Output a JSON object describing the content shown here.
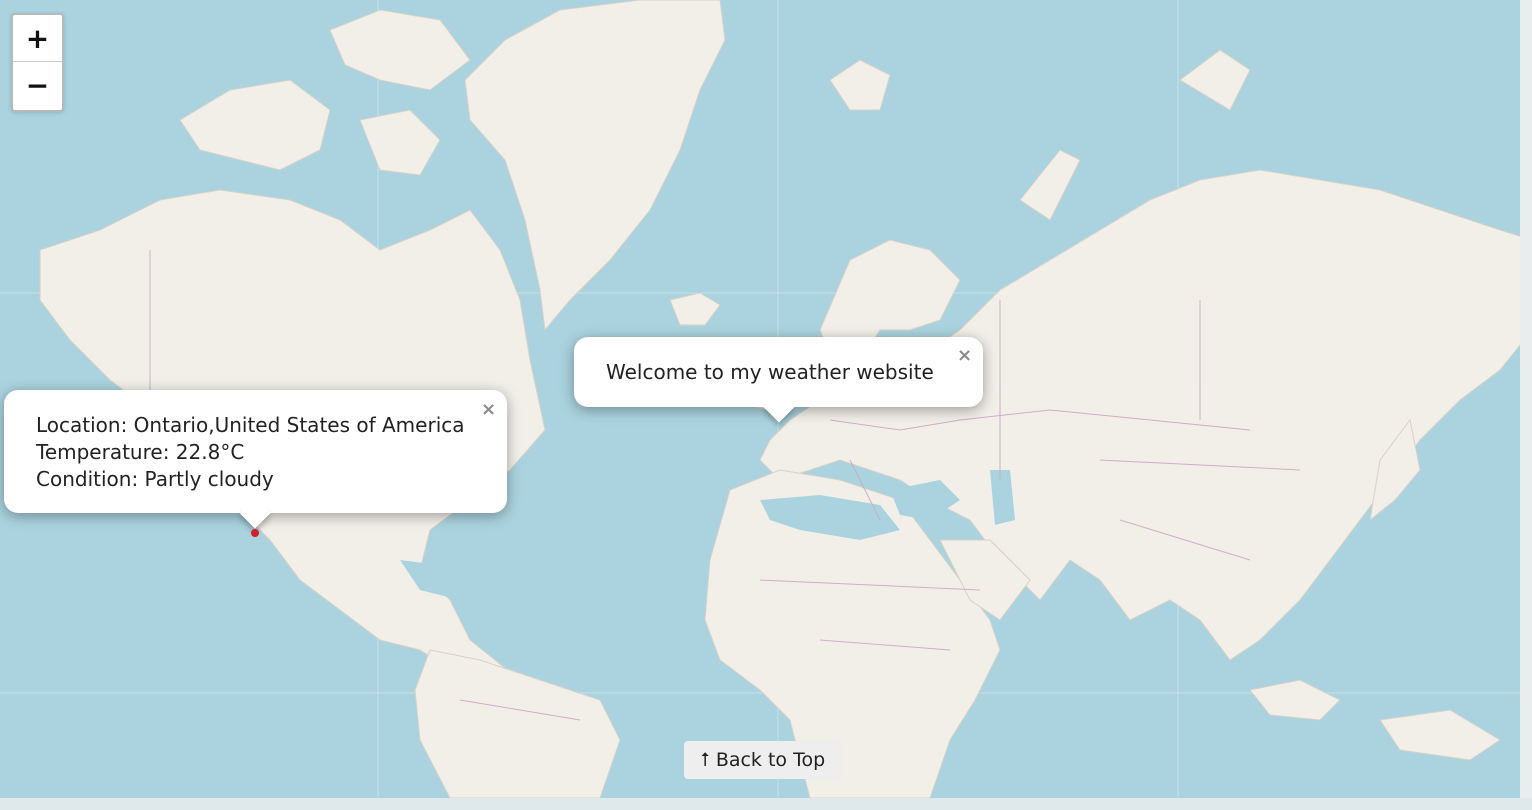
{
  "map": {
    "zoom_in_label": "+",
    "zoom_out_label": "−",
    "land_color": "#f2efe9",
    "water_color": "#aad3df",
    "border_color": "#c9a8c4",
    "marker_color": "#d0202a"
  },
  "welcome_popup": {
    "text": "Welcome to my weather website",
    "close_label": "×"
  },
  "weather_popup": {
    "close_label": "×",
    "location": "Location: Ontario,United States of America",
    "temperature": "Temperature: 22.8°C",
    "condition": "Condition: Partly cloudy"
  },
  "back_to_top": {
    "label": "⭡ Back to Top"
  }
}
